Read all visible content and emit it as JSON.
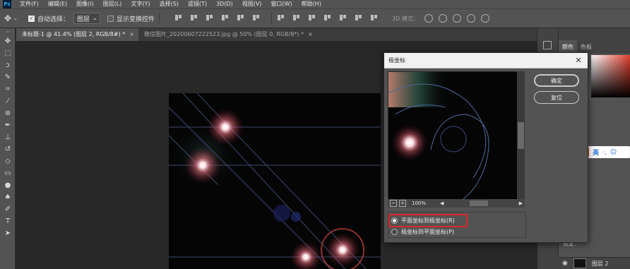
{
  "app": {
    "logo": "Ps"
  },
  "menu": [
    "文件(F)",
    "编辑(E)",
    "图像(I)",
    "图层(L)",
    "文字(Y)",
    "选择(S)",
    "滤镜(T)",
    "3D(D)",
    "视图(V)",
    "窗口(W)",
    "帮助(H)"
  ],
  "options_bar": {
    "auto_select_label": "自动选择：",
    "auto_select_checked": true,
    "auto_select_target": "图层",
    "show_transform_label": "显示变换控件",
    "show_transform_checked": false,
    "mode_3d_label": "3D 模式："
  },
  "tabs": [
    {
      "title": "未标题-1 @ 41.4% (图层 2, RGB/8#) *",
      "active": true
    },
    {
      "title": "微信图片_20200607222523.jpg @ 50% (图层 0, RGB/8*) *",
      "active": false
    }
  ],
  "right_panel": {
    "tabs": [
      "颜色",
      "色板"
    ],
    "layers_label_lock": "锁定：",
    "layer_name": "图层 2"
  },
  "dialog": {
    "title": "极坐标",
    "ok_label": "确定",
    "reset_label": "复位",
    "zoom": "100%",
    "option_1": "平面坐标到极坐标(R)",
    "option_2": "极坐标到平面坐标(P)",
    "selected_option": 1
  },
  "ime": {
    "mode": "英"
  },
  "colors": {
    "accent_highlight": "#e0252b",
    "ui_panel": "#535353",
    "canvas_bg": "#050505"
  }
}
